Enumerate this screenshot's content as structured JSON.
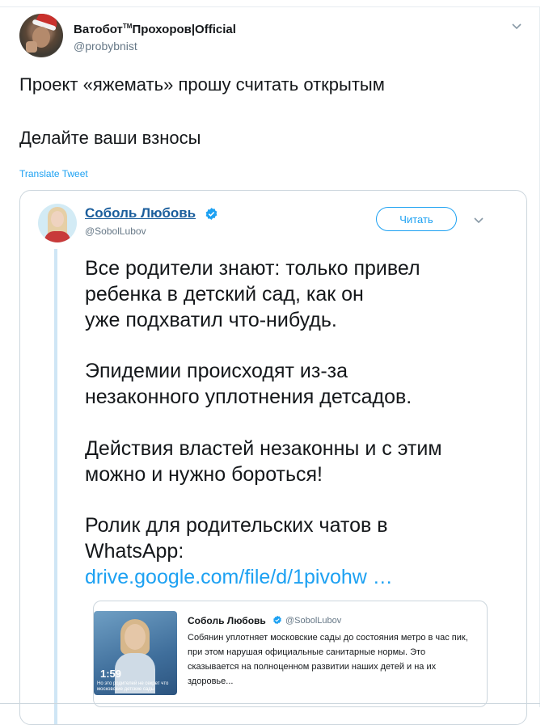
{
  "tweet": {
    "display_name": "Ватобот",
    "trademark": "TM",
    "display_name_suffix": "Прохоров|Official",
    "handle": "@probybnist",
    "text_line1": "Проект «яжемать» прошу считать открытым",
    "text_line2": "Делайте ваши взносы",
    "translate_label": "Translate Tweet"
  },
  "quoted": {
    "display_name": "Соболь Любовь",
    "handle": "@SobolLubov",
    "follow_label": "Читать",
    "lines": [
      "Все родители знают: только привел",
      "ребенка в детский сад, как он",
      "уже подхватил что-нибудь.",
      "Эпидемии происходят из-за",
      "незаконного уплотнения детсадов.",
      "Действия властей незаконны и с этим",
      "можно и нужно бороться!",
      "Ролик для родительских чатов в",
      "WhatsApp:"
    ],
    "link": "drive.google.com/file/d/1pivohw …"
  },
  "card": {
    "duration": "1:59",
    "thumb_caption": "Но это родителей не секрет что московские детские сады",
    "name": "Соболь Любовь",
    "handle": "@SobolLubov",
    "body": "Собянин уплотняет московские сады до состояния метро в час пик, при этом нарушая официальные санитарные нормы. Это сказывается на полноценном развитии наших детей и на их здоровье..."
  },
  "colors": {
    "accent": "#1da1f2",
    "name_link": "#1b5e9c",
    "muted": "#657786",
    "border": "#ccd6dd"
  },
  "icons": [
    "chevron-down-icon",
    "verified-badge-icon"
  ]
}
